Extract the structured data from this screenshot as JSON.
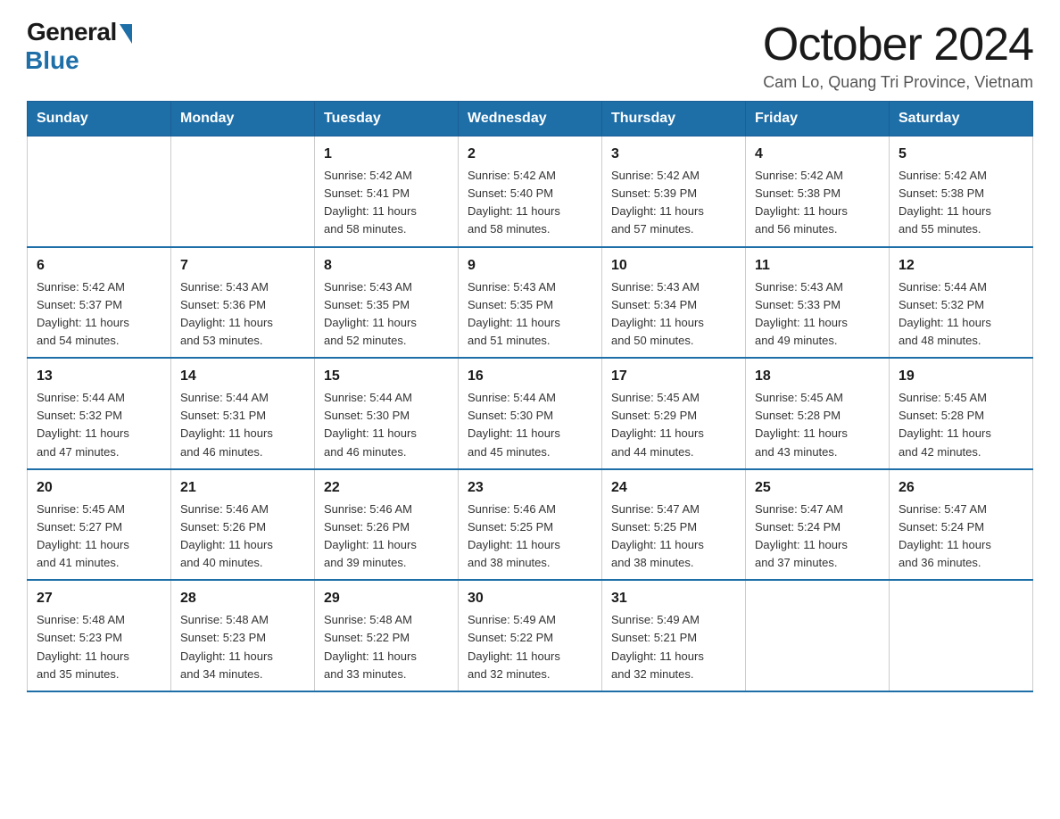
{
  "logo": {
    "general": "General",
    "blue": "Blue"
  },
  "header": {
    "month_title": "October 2024",
    "subtitle": "Cam Lo, Quang Tri Province, Vietnam"
  },
  "weekdays": [
    "Sunday",
    "Monday",
    "Tuesday",
    "Wednesday",
    "Thursday",
    "Friday",
    "Saturday"
  ],
  "weeks": [
    [
      {
        "day": "",
        "info": ""
      },
      {
        "day": "",
        "info": ""
      },
      {
        "day": "1",
        "info": "Sunrise: 5:42 AM\nSunset: 5:41 PM\nDaylight: 11 hours\nand 58 minutes."
      },
      {
        "day": "2",
        "info": "Sunrise: 5:42 AM\nSunset: 5:40 PM\nDaylight: 11 hours\nand 58 minutes."
      },
      {
        "day": "3",
        "info": "Sunrise: 5:42 AM\nSunset: 5:39 PM\nDaylight: 11 hours\nand 57 minutes."
      },
      {
        "day": "4",
        "info": "Sunrise: 5:42 AM\nSunset: 5:38 PM\nDaylight: 11 hours\nand 56 minutes."
      },
      {
        "day": "5",
        "info": "Sunrise: 5:42 AM\nSunset: 5:38 PM\nDaylight: 11 hours\nand 55 minutes."
      }
    ],
    [
      {
        "day": "6",
        "info": "Sunrise: 5:42 AM\nSunset: 5:37 PM\nDaylight: 11 hours\nand 54 minutes."
      },
      {
        "day": "7",
        "info": "Sunrise: 5:43 AM\nSunset: 5:36 PM\nDaylight: 11 hours\nand 53 minutes."
      },
      {
        "day": "8",
        "info": "Sunrise: 5:43 AM\nSunset: 5:35 PM\nDaylight: 11 hours\nand 52 minutes."
      },
      {
        "day": "9",
        "info": "Sunrise: 5:43 AM\nSunset: 5:35 PM\nDaylight: 11 hours\nand 51 minutes."
      },
      {
        "day": "10",
        "info": "Sunrise: 5:43 AM\nSunset: 5:34 PM\nDaylight: 11 hours\nand 50 minutes."
      },
      {
        "day": "11",
        "info": "Sunrise: 5:43 AM\nSunset: 5:33 PM\nDaylight: 11 hours\nand 49 minutes."
      },
      {
        "day": "12",
        "info": "Sunrise: 5:44 AM\nSunset: 5:32 PM\nDaylight: 11 hours\nand 48 minutes."
      }
    ],
    [
      {
        "day": "13",
        "info": "Sunrise: 5:44 AM\nSunset: 5:32 PM\nDaylight: 11 hours\nand 47 minutes."
      },
      {
        "day": "14",
        "info": "Sunrise: 5:44 AM\nSunset: 5:31 PM\nDaylight: 11 hours\nand 46 minutes."
      },
      {
        "day": "15",
        "info": "Sunrise: 5:44 AM\nSunset: 5:30 PM\nDaylight: 11 hours\nand 46 minutes."
      },
      {
        "day": "16",
        "info": "Sunrise: 5:44 AM\nSunset: 5:30 PM\nDaylight: 11 hours\nand 45 minutes."
      },
      {
        "day": "17",
        "info": "Sunrise: 5:45 AM\nSunset: 5:29 PM\nDaylight: 11 hours\nand 44 minutes."
      },
      {
        "day": "18",
        "info": "Sunrise: 5:45 AM\nSunset: 5:28 PM\nDaylight: 11 hours\nand 43 minutes."
      },
      {
        "day": "19",
        "info": "Sunrise: 5:45 AM\nSunset: 5:28 PM\nDaylight: 11 hours\nand 42 minutes."
      }
    ],
    [
      {
        "day": "20",
        "info": "Sunrise: 5:45 AM\nSunset: 5:27 PM\nDaylight: 11 hours\nand 41 minutes."
      },
      {
        "day": "21",
        "info": "Sunrise: 5:46 AM\nSunset: 5:26 PM\nDaylight: 11 hours\nand 40 minutes."
      },
      {
        "day": "22",
        "info": "Sunrise: 5:46 AM\nSunset: 5:26 PM\nDaylight: 11 hours\nand 39 minutes."
      },
      {
        "day": "23",
        "info": "Sunrise: 5:46 AM\nSunset: 5:25 PM\nDaylight: 11 hours\nand 38 minutes."
      },
      {
        "day": "24",
        "info": "Sunrise: 5:47 AM\nSunset: 5:25 PM\nDaylight: 11 hours\nand 38 minutes."
      },
      {
        "day": "25",
        "info": "Sunrise: 5:47 AM\nSunset: 5:24 PM\nDaylight: 11 hours\nand 37 minutes."
      },
      {
        "day": "26",
        "info": "Sunrise: 5:47 AM\nSunset: 5:24 PM\nDaylight: 11 hours\nand 36 minutes."
      }
    ],
    [
      {
        "day": "27",
        "info": "Sunrise: 5:48 AM\nSunset: 5:23 PM\nDaylight: 11 hours\nand 35 minutes."
      },
      {
        "day": "28",
        "info": "Sunrise: 5:48 AM\nSunset: 5:23 PM\nDaylight: 11 hours\nand 34 minutes."
      },
      {
        "day": "29",
        "info": "Sunrise: 5:48 AM\nSunset: 5:22 PM\nDaylight: 11 hours\nand 33 minutes."
      },
      {
        "day": "30",
        "info": "Sunrise: 5:49 AM\nSunset: 5:22 PM\nDaylight: 11 hours\nand 32 minutes."
      },
      {
        "day": "31",
        "info": "Sunrise: 5:49 AM\nSunset: 5:21 PM\nDaylight: 11 hours\nand 32 minutes."
      },
      {
        "day": "",
        "info": ""
      },
      {
        "day": "",
        "info": ""
      }
    ]
  ]
}
